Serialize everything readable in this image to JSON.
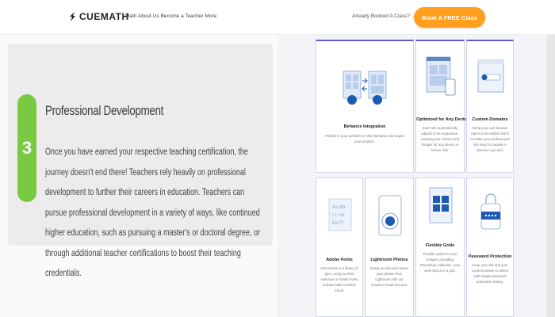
{
  "header": {
    "logo_text": "CUEMATH",
    "nav_links": "Math  About Us  Become a Teacher  More",
    "booked_text": "Already Booked A Class?",
    "cta_label": "Book A FREE Class"
  },
  "step": {
    "number": "3",
    "title": "Professional Development",
    "body": "Once you have earned your respective teaching certification, the journey doesn't end there! Teachers rely heavily on professional development to further their careers in education. Teachers can pursue professional development in a variety of ways, like continued higher education, such as pursuing a master's or doctoral degree, or through additional teacher certifications to boost their teaching credentials."
  },
  "tiles": [
    {
      "title": "Behance Integration",
      "desc": "Publish to your portfolio or other Behance site import your projects."
    },
    {
      "title": "Optimized for Any Device",
      "desc": "Each site automatically adjusts to be responsive, resizing your content and images for any device or screen size."
    },
    {
      "title": "Custom Domains",
      "desc": "Bring your own domain name or let Adobe host it to make your professional site easy for people to discover you and."
    },
    {
      "title": "Adobe Fonts",
      "desc": "Get access to a library of type, using our font selection or Adobe Fonts included with Creative Cloud."
    },
    {
      "title": "Lightroom Photos",
      "desc": "Easily access and import your photos from Lightroom with our Creative Cloud account."
    },
    {
      "title": "Flexible Grids",
      "desc": "Flexible works for your images, providing Photoshop collection, your work layout in a grid."
    },
    {
      "title": "Password Protection",
      "desc": "Keep your site and your content private to others with simple password protection setting."
    }
  ]
}
